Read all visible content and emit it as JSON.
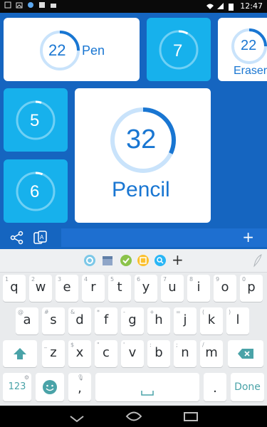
{
  "status": {
    "time": "12:47"
  },
  "tiles": {
    "pen": {
      "number": "22",
      "word": "Pen",
      "progress": 0.25
    },
    "seven": {
      "number": "7",
      "progress": 0.08
    },
    "eraser": {
      "number": "22",
      "word": "Eraser",
      "progress": 0.25
    },
    "five": {
      "number": "5",
      "progress": 0.05
    },
    "pencil": {
      "number": "32",
      "word": "Pencil",
      "progress": 0.32
    },
    "six": {
      "number": "6",
      "progress": 0.06
    }
  },
  "bottombar": {
    "plus": "+"
  },
  "keyboard": {
    "suggest_plus": "+",
    "row1": [
      {
        "hint": "1",
        "key": "q"
      },
      {
        "hint": "2",
        "key": "w"
      },
      {
        "hint": "3",
        "key": "e"
      },
      {
        "hint": "4",
        "key": "r"
      },
      {
        "hint": "5",
        "key": "t"
      },
      {
        "hint": "6",
        "key": "y"
      },
      {
        "hint": "7",
        "key": "u"
      },
      {
        "hint": "8",
        "key": "i"
      },
      {
        "hint": "9",
        "key": "o"
      },
      {
        "hint": "0",
        "key": "p"
      }
    ],
    "row2": [
      {
        "hint": "@",
        "key": "a"
      },
      {
        "hint": "#",
        "key": "s"
      },
      {
        "hint": "&",
        "key": "d"
      },
      {
        "hint": "*",
        "key": "f"
      },
      {
        "hint": "-",
        "key": "g"
      },
      {
        "hint": "+",
        "key": "h"
      },
      {
        "hint": "=",
        "key": "j"
      },
      {
        "hint": "(",
        "key": "k"
      },
      {
        "hint": ")",
        "key": "l"
      }
    ],
    "row3": [
      {
        "hint": "_",
        "key": "z"
      },
      {
        "hint": "$",
        "key": "x"
      },
      {
        "hint": "\"",
        "key": "c"
      },
      {
        "hint": "'",
        "key": "v"
      },
      {
        "hint": ":",
        "key": "b"
      },
      {
        "hint": ";",
        "key": "n"
      },
      {
        "hint": "/",
        "key": "m"
      }
    ],
    "num_label": "123",
    "comma": ",",
    "period": ".",
    "done": "Done"
  },
  "colors": {
    "background_blue": "#1565c0",
    "tile_cyan": "#17b1ec",
    "ring_blue": "#1976d2",
    "ring_light": "#c9e3fb"
  }
}
